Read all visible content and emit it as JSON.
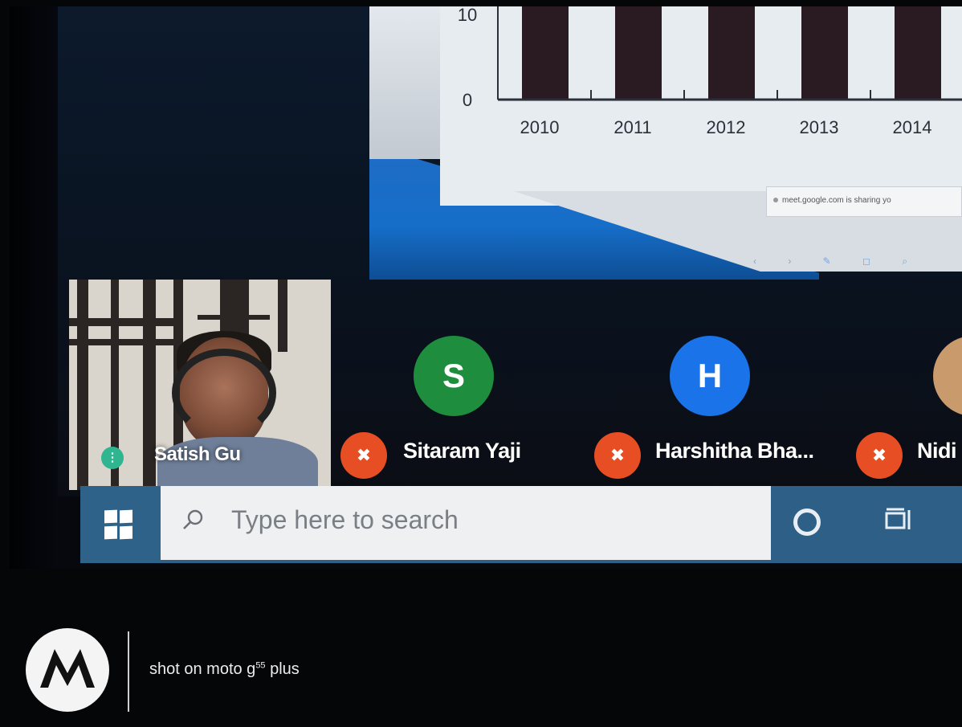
{
  "presentation": {
    "chart_data": {
      "type": "bar",
      "categories": [
        "2010",
        "2011",
        "2012",
        "2013",
        "2014"
      ],
      "y_ticks": [
        "0",
        "10"
      ],
      "ylim": [
        0,
        10
      ]
    },
    "share_notice": "meet.google.com is sharing yo"
  },
  "self_tile": {
    "name": "Satish Gu",
    "status_color": "#2fb58f"
  },
  "participants": [
    {
      "initial": "S",
      "name": "Sitaram Yaji",
      "avatar_color": "#1e8e3e",
      "muted": true
    },
    {
      "initial": "H",
      "name": "Harshitha Bha...",
      "avatar_color": "#1a73e8",
      "muted": true
    },
    {
      "initial": "",
      "name": "Nidi",
      "avatar_color": "#c99a6b",
      "muted": true
    }
  ],
  "taskbar": {
    "search_placeholder": "Type here to search",
    "accent": "#2e5f86"
  },
  "watermark": {
    "text_prefix": "shot on moto g",
    "text_sup": "55",
    "text_suffix": " plus"
  }
}
